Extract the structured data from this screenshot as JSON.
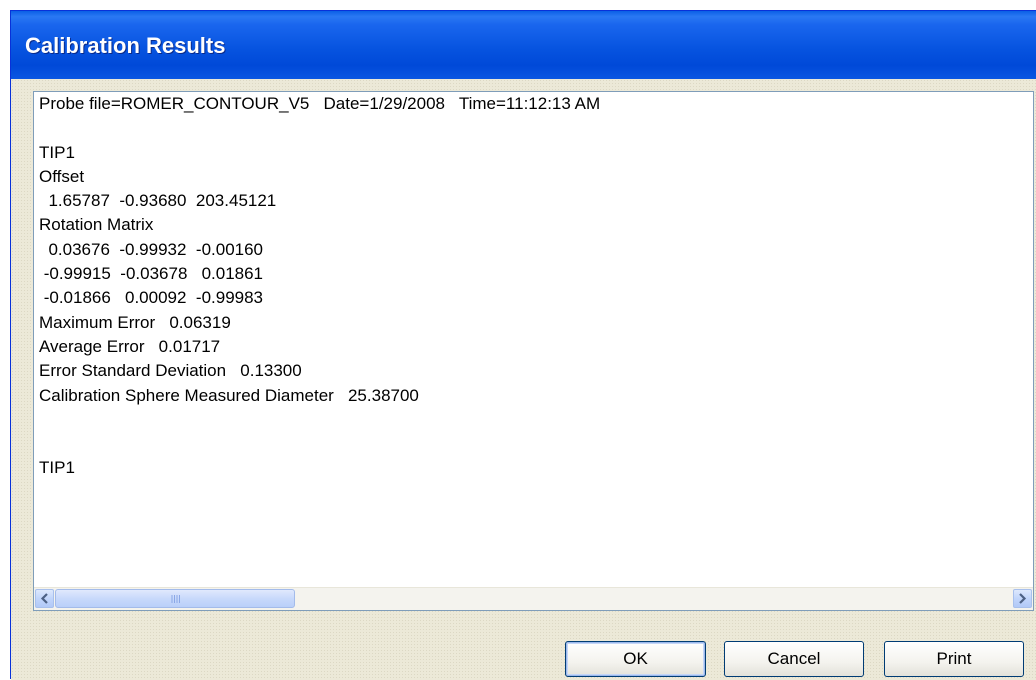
{
  "window": {
    "title": "Calibration Results"
  },
  "results": {
    "lines": [
      "Probe file=ROMER_CONTOUR_V5   Date=1/29/2008   Time=11:12:13 AM",
      "",
      "TIP1",
      "Offset",
      "  1.65787  -0.93680  203.45121",
      "Rotation Matrix",
      "  0.03676  -0.99932  -0.00160",
      " -0.99915  -0.03678   0.01861",
      " -0.01866   0.00092  -0.99983",
      "Maximum Error   0.06319",
      "Average Error   0.01717",
      "Error Standard Deviation   0.13300",
      "Calibration Sphere Measured Diameter   25.38700",
      "",
      "",
      "TIP1"
    ]
  },
  "scrollbar": {
    "position_fraction": 0.0,
    "thumb_fraction": 0.24
  },
  "buttons": {
    "ok_label": "OK",
    "cancel_label": "Cancel",
    "print_label": "Print"
  },
  "colors": {
    "titlebar": "#0754e0",
    "dialog_background": "#ece9d8",
    "button_border": "#003c74"
  }
}
